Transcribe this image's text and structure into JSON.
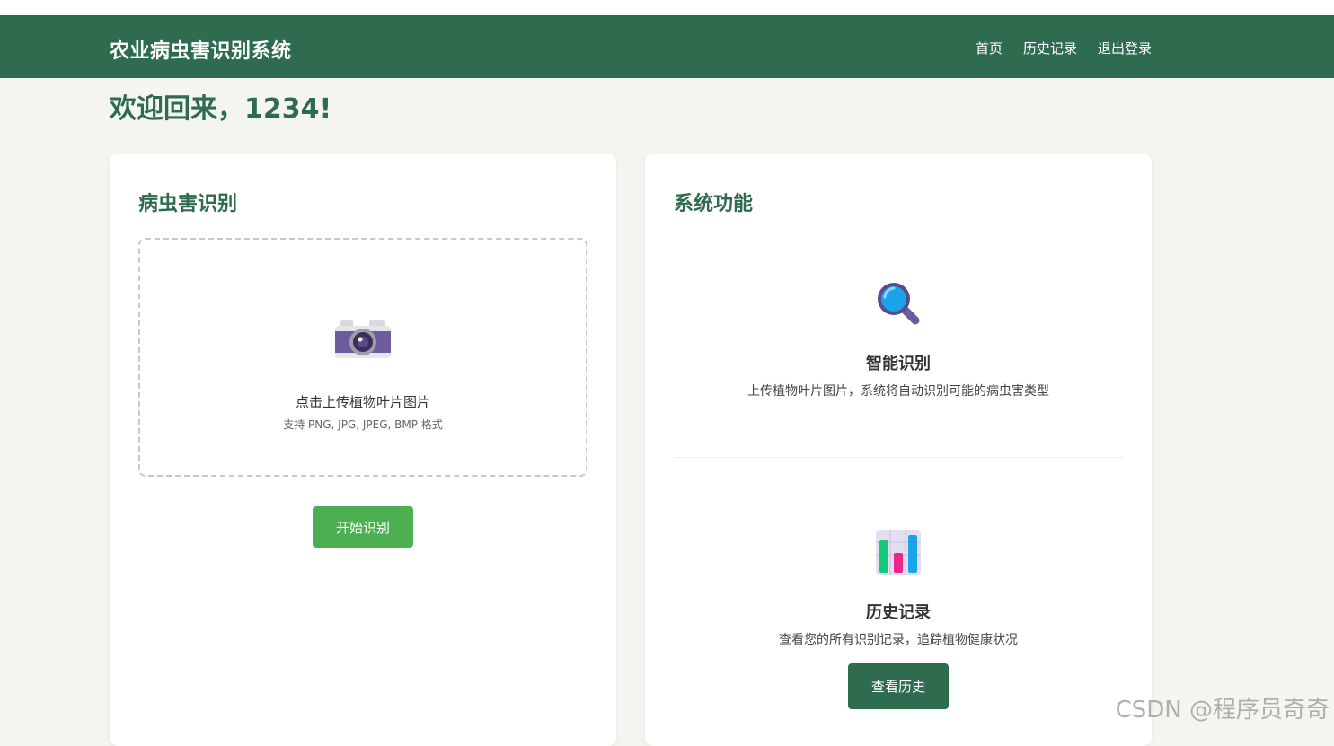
{
  "header": {
    "brand": "农业病虫害识别系统",
    "nav": [
      "首页",
      "历史记录",
      "退出登录"
    ]
  },
  "welcome": "欢迎回来，1234!",
  "identify_card": {
    "title": "病虫害识别",
    "upload_text": "点击上传植物叶片图片",
    "upload_hint": "支持 PNG, JPG, JPEG, BMP 格式",
    "start_button": "开始识别",
    "icon": "camera-icon"
  },
  "features_card": {
    "title": "系统功能",
    "features": [
      {
        "icon": "magnifier-icon",
        "title": "智能识别",
        "desc": "上传植物叶片图片，系统将自动识别可能的病虫害类型"
      },
      {
        "icon": "bar-chart-icon",
        "title": "历史记录",
        "desc": "查看您的所有识别记录，追踪植物健康状况"
      }
    ],
    "history_button": "查看历史"
  },
  "watermark": "CSDN @程序员奇奇",
  "colors": {
    "primary": "#2e6b4f",
    "accent": "#4caf50",
    "background": "#f5f5f0"
  }
}
